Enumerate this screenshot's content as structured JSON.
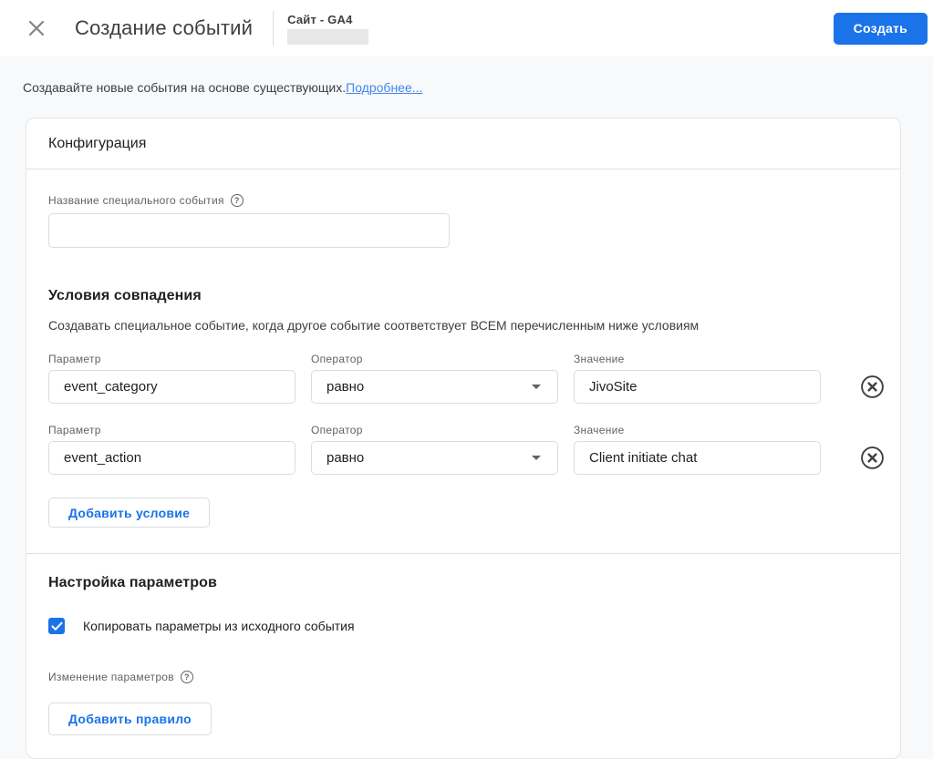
{
  "header": {
    "title": "Создание событий",
    "property_label": "Сайт - GA4",
    "create_button": "Создать"
  },
  "intro": {
    "text": "Создавайте новые события на основе существующих.",
    "link": "Подробнее..."
  },
  "card": {
    "title": "Конфигурация",
    "event_name": {
      "label": "Название специального события",
      "value": "",
      "help_icon": "question-mark"
    },
    "conditions": {
      "title": "Условия совпадения",
      "description": "Создавать специальное событие, когда другое событие соответствует ВСЕМ перечисленным ниже условиям",
      "columns": {
        "parameter": "Параметр",
        "operator": "Оператор",
        "value": "Значение"
      },
      "rows": [
        {
          "parameter": "event_category",
          "operator": "равно",
          "value": "JivoSite"
        },
        {
          "parameter": "event_action",
          "operator": "равно",
          "value": "Client initiate chat"
        }
      ],
      "add_button": "Добавить условие"
    },
    "parameters": {
      "title": "Настройка параметров",
      "copy_checkbox": {
        "checked": "true",
        "label": "Копировать параметры из исходного события"
      },
      "modify_label": "Изменение параметров",
      "modify_help_icon": "question-mark",
      "add_rule_button": "Добавить правило"
    }
  },
  "colors": {
    "accent_blue": "#1a73e8",
    "link_blue": "#4285f4",
    "border_gray": "#dadce0",
    "text_primary": "#202124",
    "text_secondary": "#5f6368",
    "page_background": "#f8f9fa"
  }
}
